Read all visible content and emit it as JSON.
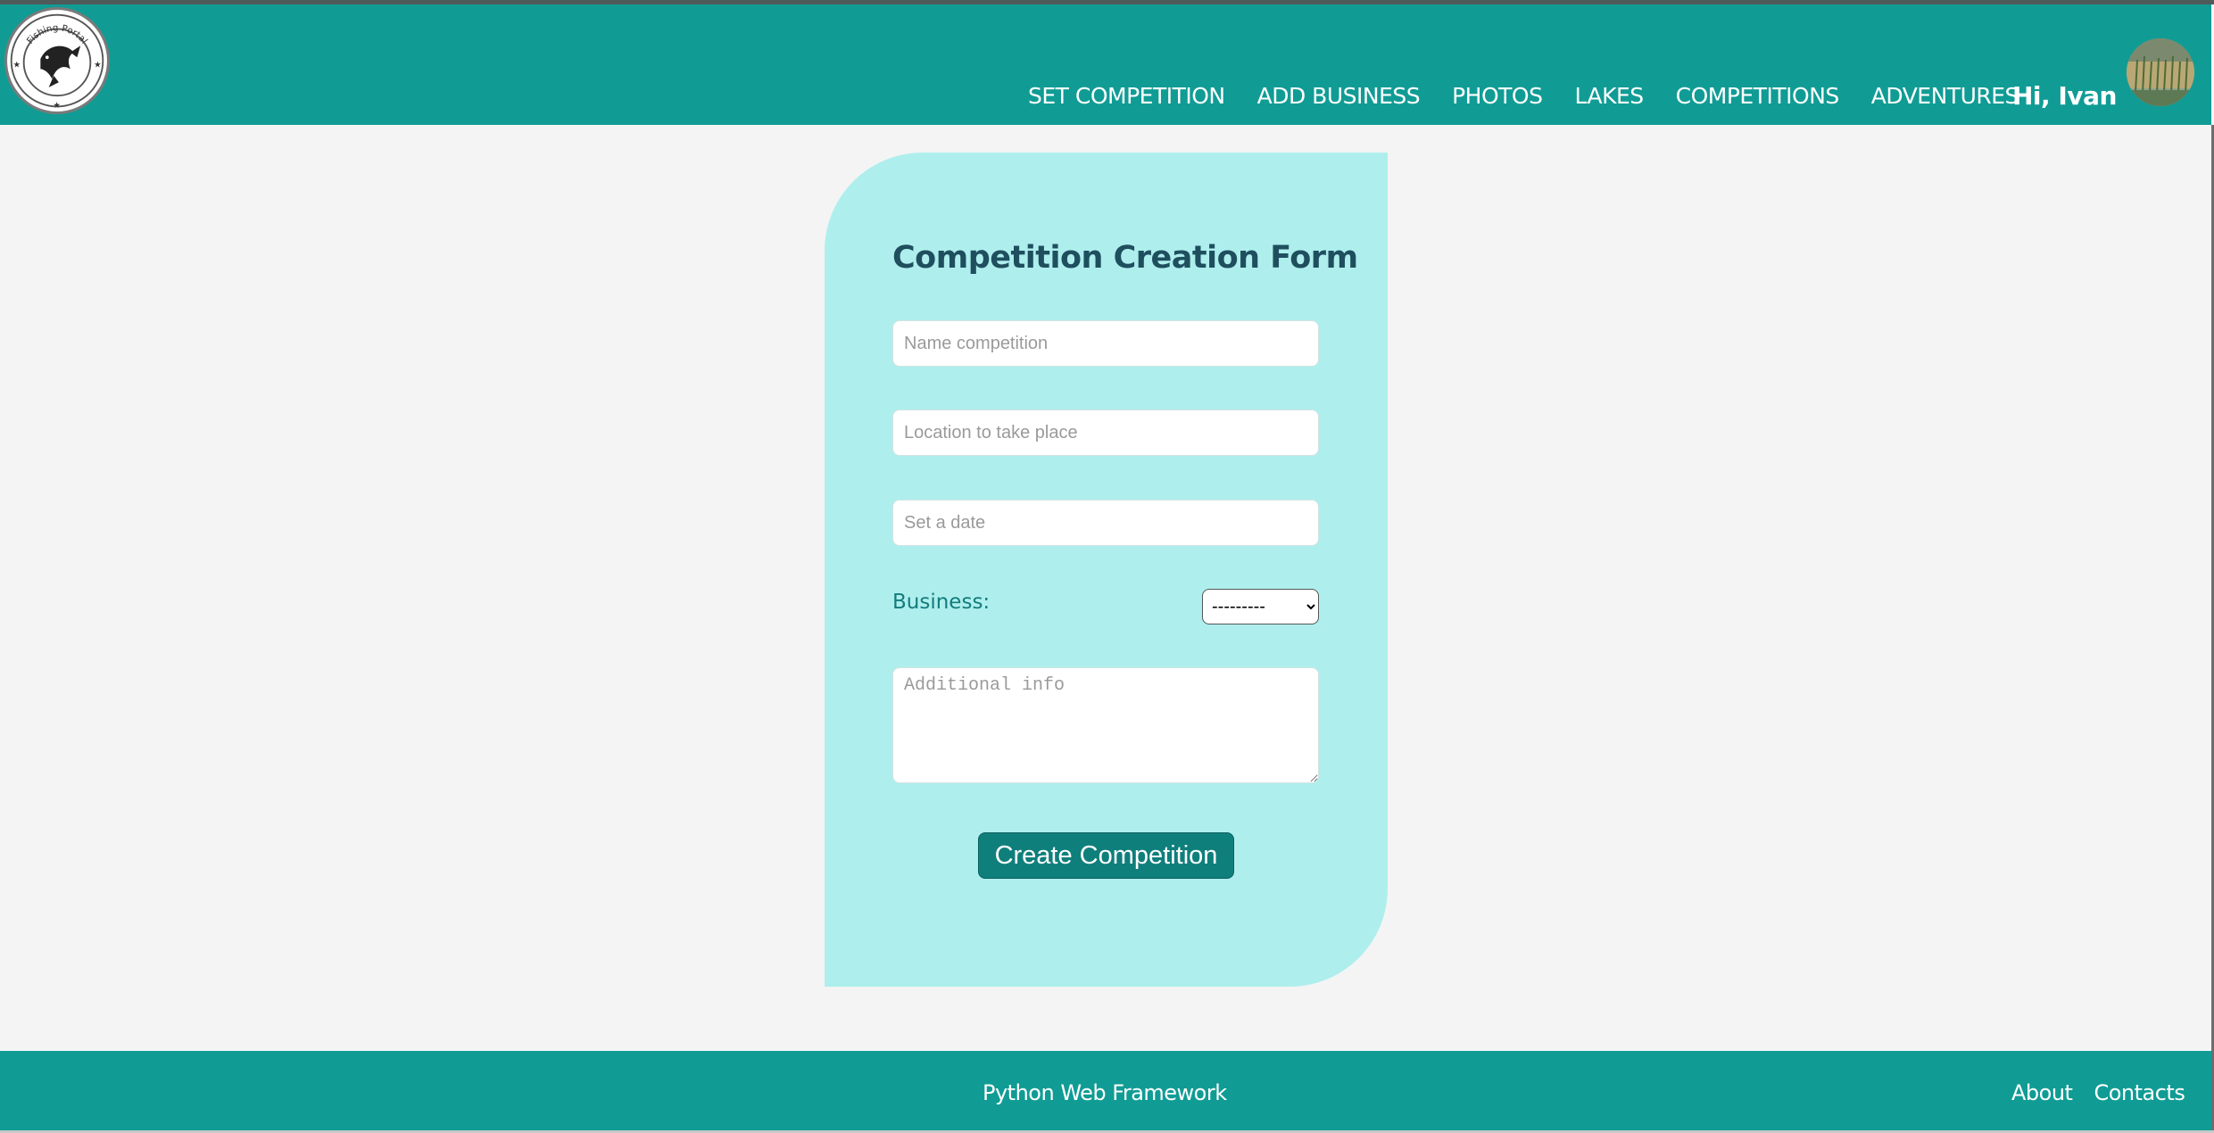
{
  "header": {
    "logo_text": "Fishing Portal",
    "nav": [
      {
        "label": "SET COMPETITION"
      },
      {
        "label": "ADD BUSINESS"
      },
      {
        "label": "PHOTOS"
      },
      {
        "label": "LAKES"
      },
      {
        "label": "COMPETITIONS"
      },
      {
        "label": "ADVENTURES"
      }
    ],
    "greeting": "Hi, Ivan"
  },
  "form": {
    "title": "Competition Creation Form",
    "name_placeholder": "Name competition",
    "location_placeholder": "Location to take place",
    "date_placeholder": "Set a date",
    "business_label": "Business:",
    "business_selected": "---------",
    "info_placeholder": "Additional info",
    "submit_label": "Create Competition"
  },
  "footer": {
    "text": "Python Web Framework",
    "links": [
      {
        "label": "About"
      },
      {
        "label": "Contacts"
      }
    ]
  },
  "colors": {
    "navbar": "#109c95",
    "card": "#aeefed",
    "button": "#0f7f7c",
    "title": "#1f4f5e",
    "background": "#f4f4f4"
  }
}
